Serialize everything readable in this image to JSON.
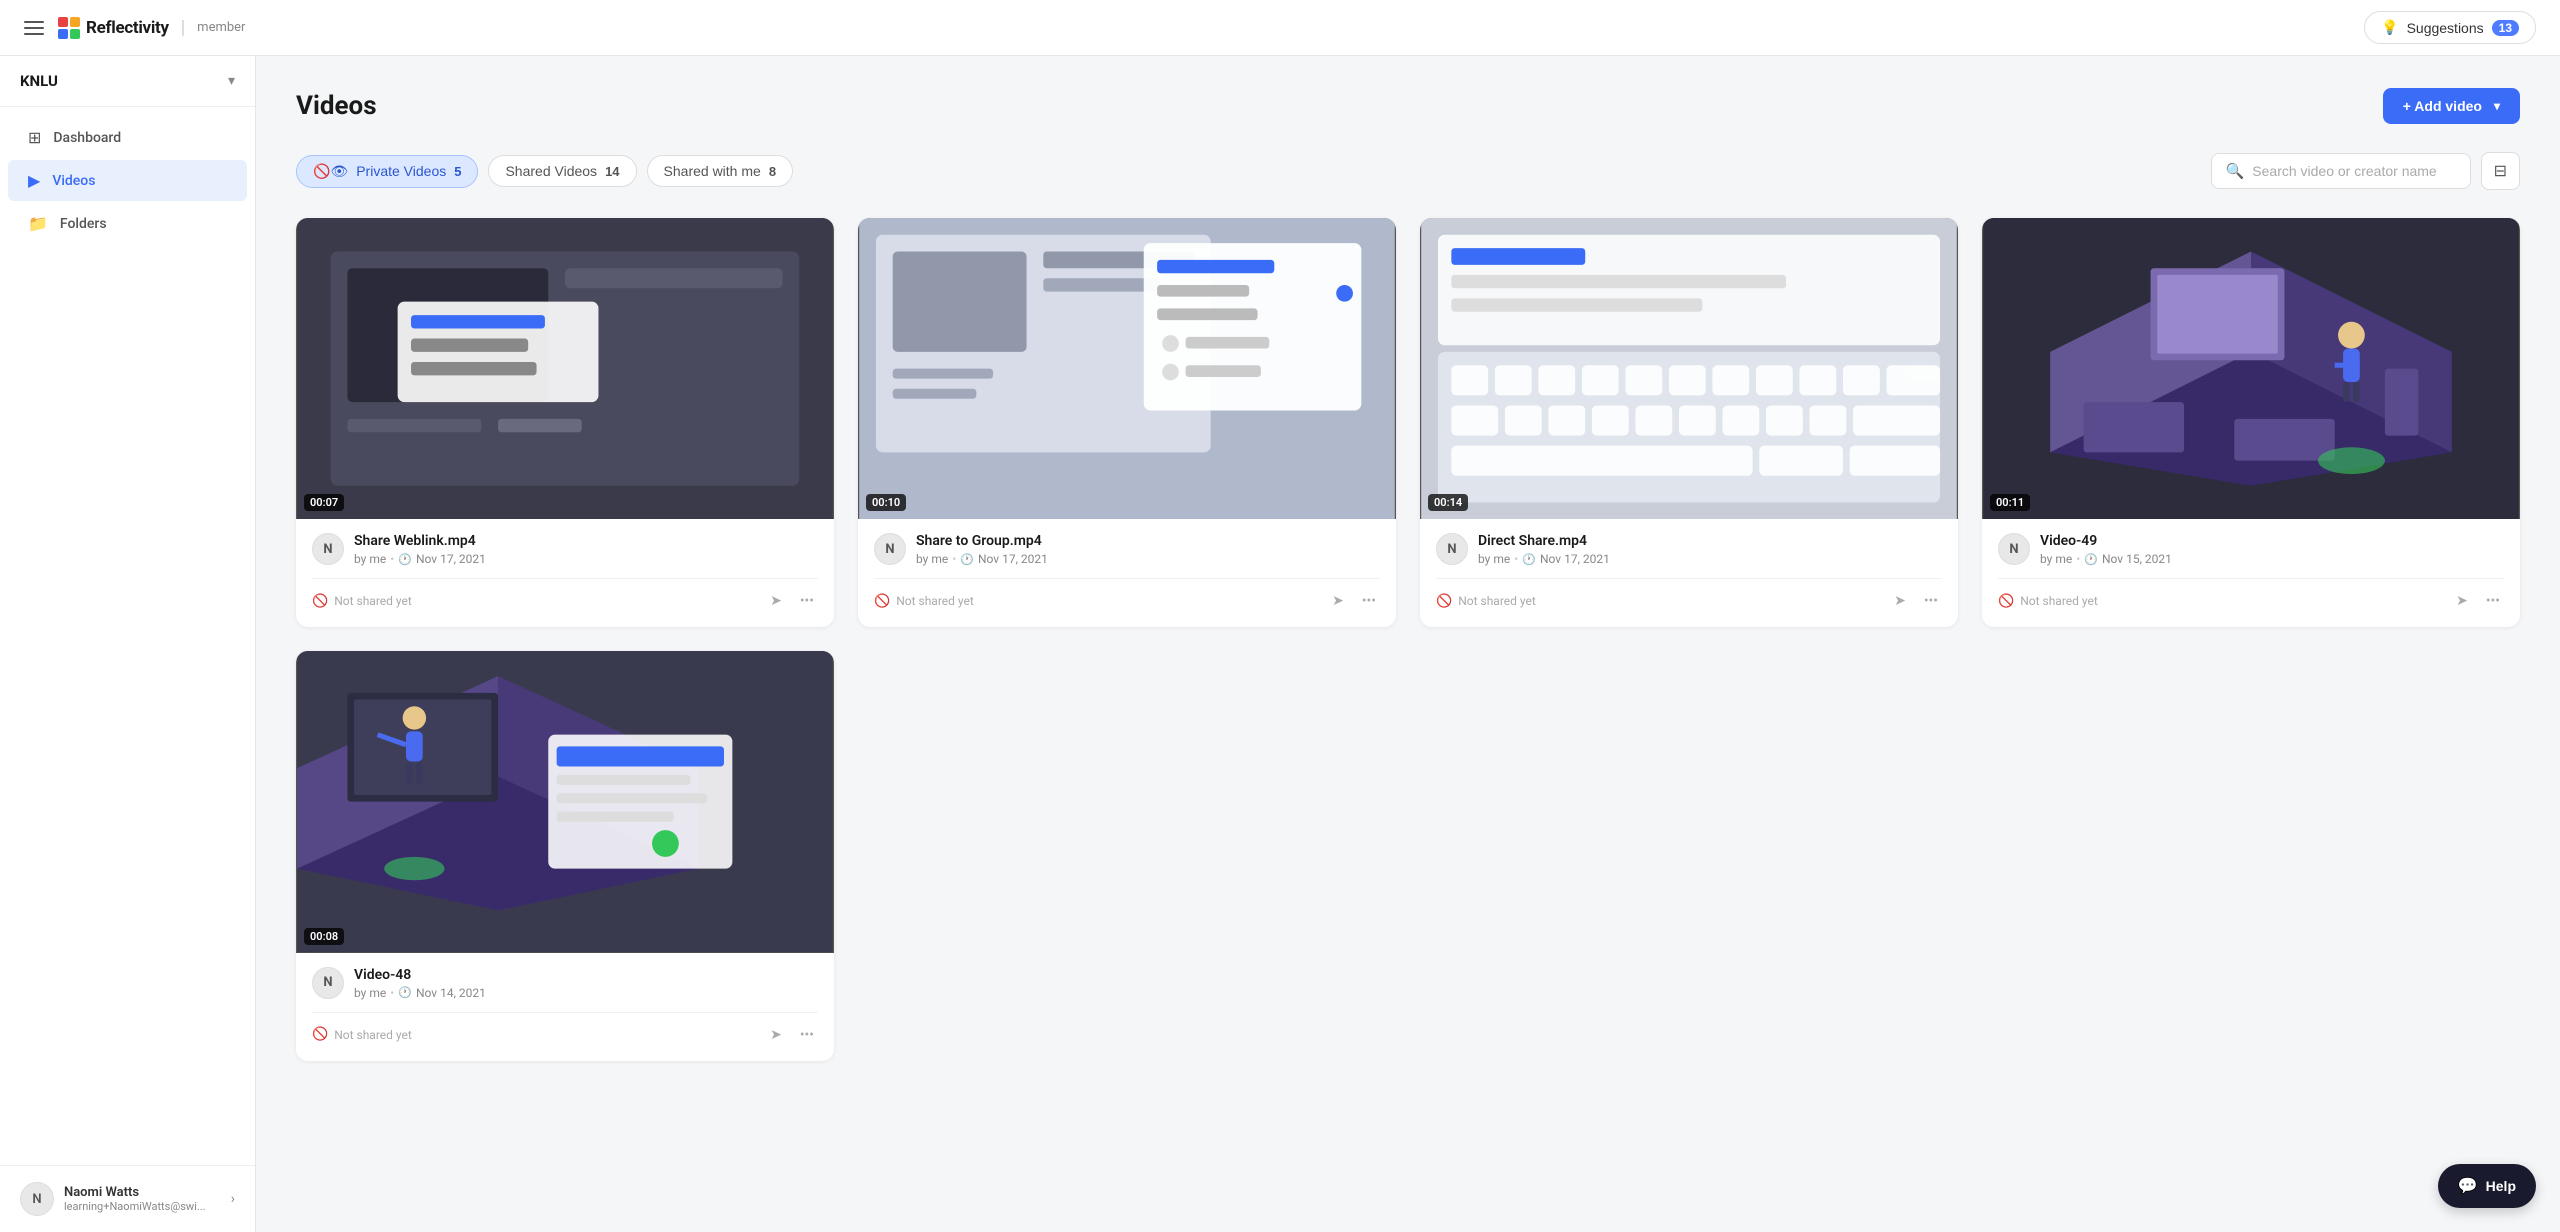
{
  "topnav": {
    "logo_name": "Reflectivity",
    "logo_divider": "|",
    "logo_role": "member",
    "suggestions_label": "Suggestions",
    "suggestions_count": "13"
  },
  "sidebar": {
    "org_name": "KNLU",
    "nav_items": [
      {
        "id": "dashboard",
        "label": "Dashboard",
        "icon": "⊞",
        "active": false
      },
      {
        "id": "videos",
        "label": "Videos",
        "icon": "▶",
        "active": true
      },
      {
        "id": "folders",
        "label": "Folders",
        "icon": "📁",
        "active": false
      }
    ],
    "user": {
      "name": "Naomi Watts",
      "email": "learning+NaomiWatts@swi...",
      "avatar_initials": "N"
    }
  },
  "page": {
    "title": "Videos",
    "add_video_label": "+ Add video"
  },
  "tabs": [
    {
      "id": "private",
      "label": "Private Videos",
      "count": "5",
      "active": true,
      "icon": "👁"
    },
    {
      "id": "shared",
      "label": "Shared Videos",
      "count": "14",
      "active": false,
      "icon": ""
    },
    {
      "id": "shared_with_me",
      "label": "Shared with me",
      "count": "8",
      "active": false,
      "icon": ""
    }
  ],
  "search": {
    "placeholder": "Search video or creator name"
  },
  "videos": [
    {
      "id": "v1",
      "title": "Share Weblink.mp4",
      "creator": "me",
      "date": "Nov 17, 2021",
      "duration": "00:07",
      "shared_status": "Not shared yet",
      "thumb_type": "dark_ui"
    },
    {
      "id": "v2",
      "title": "Share to Group.mp4",
      "creator": "me",
      "date": "Nov 17, 2021",
      "duration": "00:10",
      "shared_status": "Not shared yet",
      "thumb_type": "light_ui"
    },
    {
      "id": "v3",
      "title": "Direct Share.mp4",
      "creator": "me",
      "date": "Nov 17, 2021",
      "duration": "00:14",
      "shared_status": "Not shared yet",
      "thumb_type": "keyboard_ui"
    },
    {
      "id": "v4",
      "title": "Video-49",
      "creator": "me",
      "date": "Nov 15, 2021",
      "duration": "00:11",
      "shared_status": "Not shared yet",
      "thumb_type": "isometric"
    },
    {
      "id": "v5",
      "title": "Video-48",
      "creator": "me",
      "date": "Nov 14, 2021",
      "duration": "00:08",
      "shared_status": "Not shared yet",
      "thumb_type": "isometric2"
    }
  ],
  "help_label": "Help"
}
